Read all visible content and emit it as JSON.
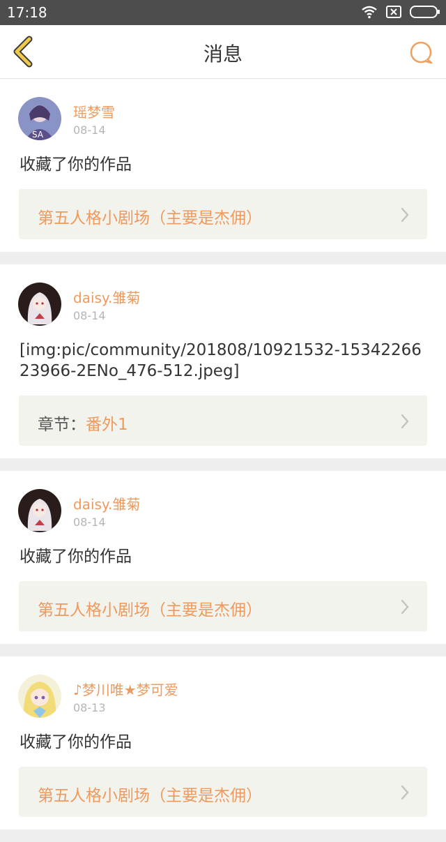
{
  "status_bar": {
    "time": "17:18",
    "icons": [
      "wifi-icon",
      "sim-none-icon",
      "battery-icon"
    ]
  },
  "header": {
    "title": "消息",
    "back_icon": "chevron-left-icon",
    "right_icon": "chat-bubble-icon",
    "accent_color": "#eea262"
  },
  "messages": [
    {
      "username": "瑶梦雪",
      "date": "08-14",
      "content": "收藏了你的作品",
      "ref_prefix": "",
      "ref_text": "第五人格小剧场（主要是杰佣）"
    },
    {
      "username": "daisy.雏菊",
      "date": "08-14",
      "content": "[img:pic/community/201808/10921532-1534226623966-2ENo_476-512.jpeg]",
      "ref_prefix": "章节：",
      "ref_text": "番外1"
    },
    {
      "username": "daisy.雏菊",
      "date": "08-14",
      "content": "收藏了你的作品",
      "ref_prefix": "",
      "ref_text": "第五人格小剧场（主要是杰佣）"
    },
    {
      "username": "♪梦川唯★梦可爱",
      "date": "08-13",
      "content": "收藏了你的作品",
      "ref_prefix": "",
      "ref_text": "第五人格小剧场（主要是杰佣）"
    }
  ]
}
